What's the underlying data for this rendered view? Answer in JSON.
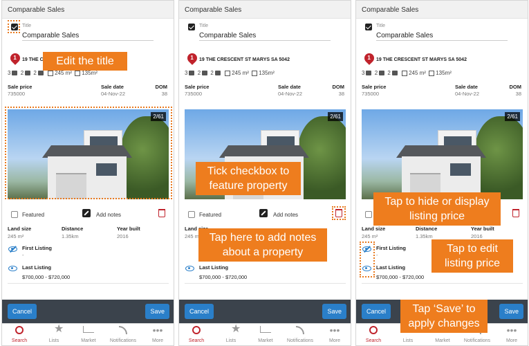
{
  "panels": [
    {
      "header": "Comparable Sales",
      "title_label": "Title",
      "title_value": "Comparable Sales",
      "pin_number": "1",
      "address": "19 THE C",
      "features": {
        "beds": "3",
        "baths": "2",
        "cars": "2",
        "land": "245 m²",
        "floor": "135m²"
      },
      "sale_price_label": "Sale price",
      "sale_price": "735000",
      "sale_date_label": "Sale date",
      "sale_date": "04-Nov-22",
      "dom_label": "DOM",
      "dom": "38",
      "photo_counter": "2/61",
      "featured_label": "Featured",
      "add_notes_label": "Add notes",
      "land_size_label": "Land size",
      "land_size": "245 m²",
      "distance_label": "Distance",
      "distance": "1.35km",
      "year_built_label": "Year built",
      "year_built": "2016",
      "first_listing_label": "First Listing",
      "first_listing": "-",
      "last_listing_label": "Last Listing",
      "last_listing": "$700,000 - $720,000",
      "cancel": "Cancel",
      "save": "Save",
      "tabs": [
        "Search",
        "Lists",
        "Market",
        "Notifications",
        "More"
      ],
      "callouts": [
        "Edit the title"
      ]
    },
    {
      "header": "Comparable Sales",
      "title_label": "Title",
      "title_value": "Comparable Sales",
      "pin_number": "1",
      "address": "19 THE CRESCENT ST MARYS SA 5042",
      "features": {
        "beds": "3",
        "baths": "2",
        "cars": "2",
        "land": "245 m²",
        "floor": "135m²"
      },
      "sale_price_label": "Sale price",
      "sale_price": "735000",
      "sale_date_label": "Sale date",
      "sale_date": "04-Nov-22",
      "dom_label": "DOM",
      "dom": "38",
      "photo_counter": "2/61",
      "featured_label": "Featured",
      "add_notes_label": "Add notes",
      "land_size_label": "Land size",
      "land_size": "245 m²",
      "distance_label": "",
      "distance": "",
      "year_built_label": "",
      "year_built": "",
      "first_listing_label": "",
      "first_listing": "",
      "last_listing_label": "Last Listing",
      "last_listing": "$700,000 - $720,000",
      "cancel": "Cancel",
      "save": "Save",
      "tabs": [
        "Search",
        "Lists",
        "Market",
        "Notifications",
        "More"
      ],
      "callouts": [
        "Tick checkbox to feature property",
        "Tap here to add notes about a property"
      ]
    },
    {
      "header": "Comparable Sales",
      "title_label": "Title",
      "title_value": "Comparable Sales",
      "pin_number": "1",
      "address": "19 THE CRESCENT ST MARYS SA 5042",
      "features": {
        "beds": "3",
        "baths": "2",
        "cars": "2",
        "land": "245 m²",
        "floor": "135m²"
      },
      "sale_price_label": "Sale price",
      "sale_price": "735000",
      "sale_date_label": "Sale date",
      "sale_date": "04-Nov-22",
      "dom_label": "DOM",
      "dom": "38",
      "photo_counter": "2/61",
      "featured_label": "",
      "add_notes_label": "",
      "land_size_label": "Land size",
      "land_size": "245 m²",
      "distance_label": "Distance",
      "distance": "1.35km",
      "year_built_label": "Year built",
      "year_built": "2016",
      "first_listing_label": "First Listing",
      "first_listing": "-",
      "last_listing_label": "Last Listing",
      "last_listing": "$700,000 - $720,000",
      "cancel": "Cancel",
      "save": "Save",
      "tabs": [
        "Search",
        "Lists",
        "Market",
        "Notifications",
        "More"
      ],
      "callouts": [
        "Tap to hide or display listing price",
        "Tap to edit listing price",
        "Tap ‘Save’ to apply changes"
      ]
    }
  ],
  "colors": {
    "accent_blue": "#2a7fc9",
    "brand_red": "#c0232c",
    "callout_orange": "#ee7d1e",
    "action_bar": "#3b434c"
  }
}
